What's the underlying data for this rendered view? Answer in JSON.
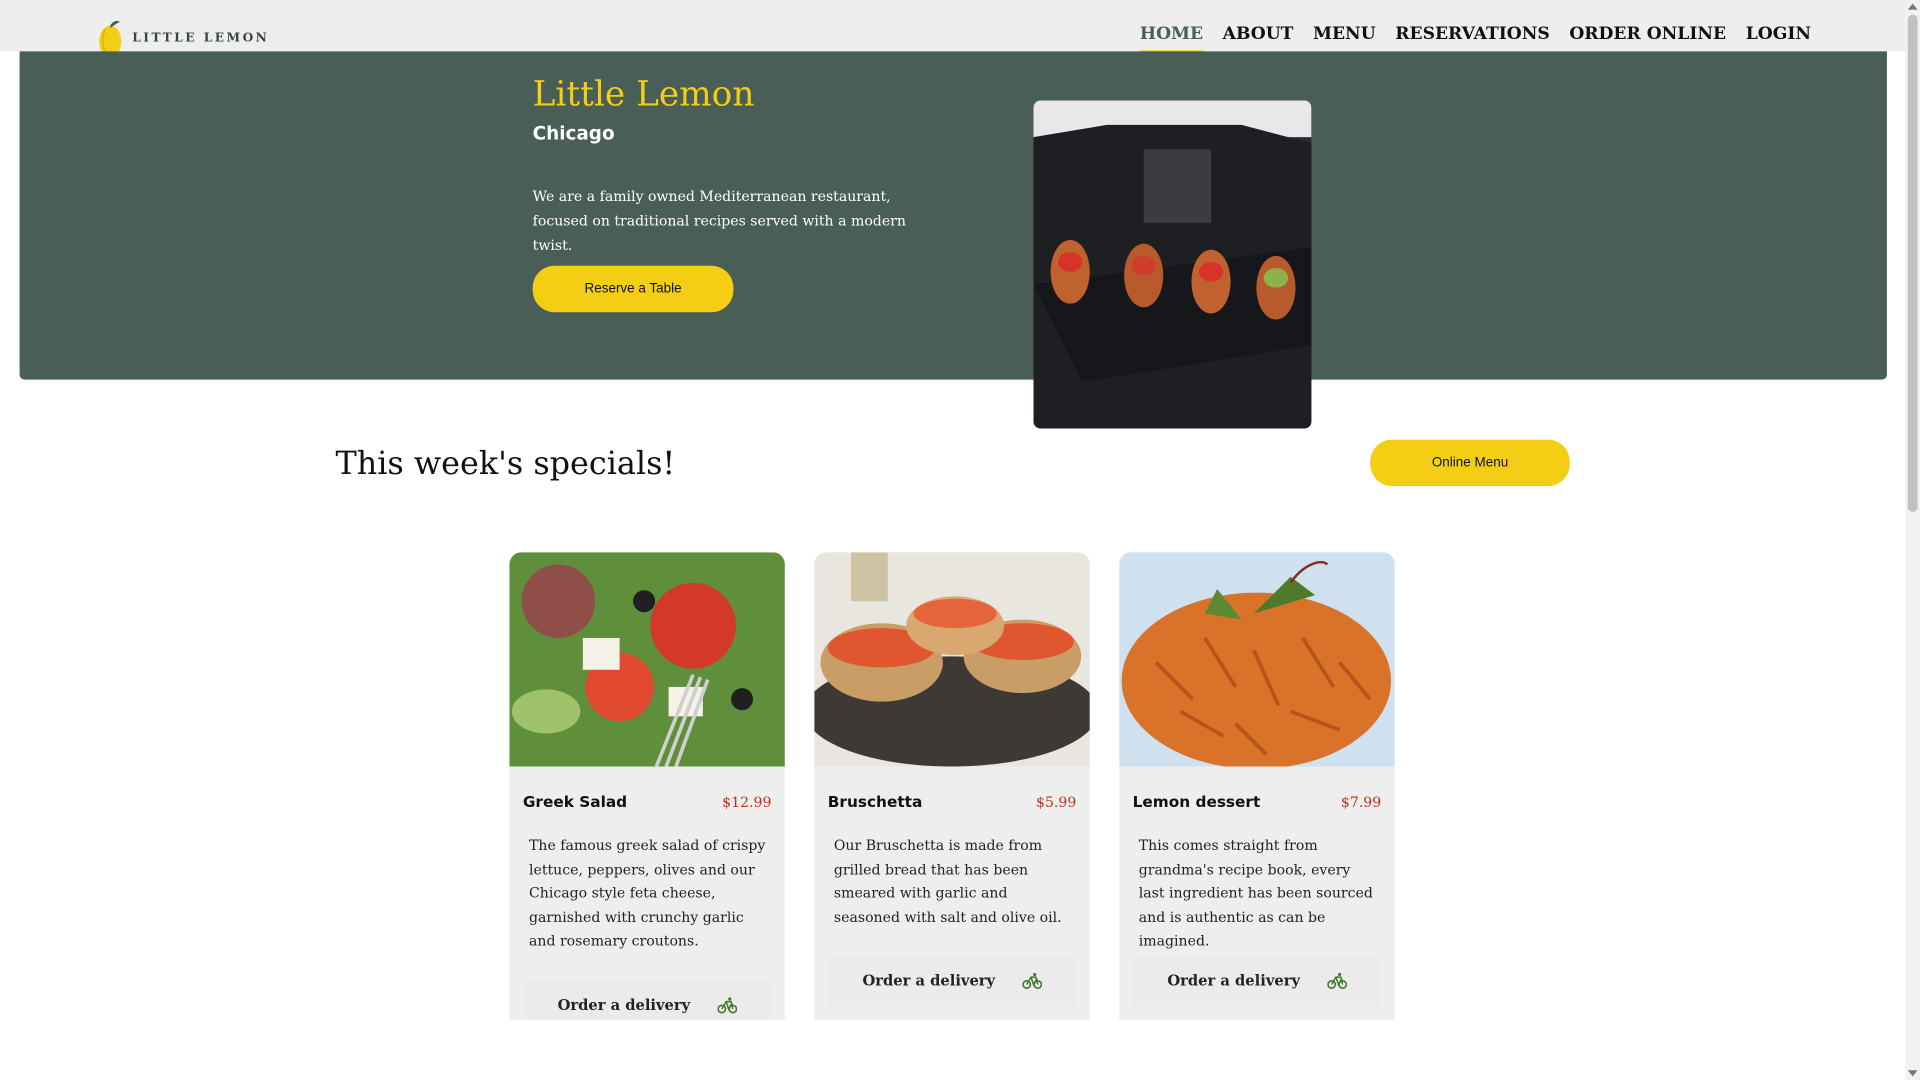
{
  "brand": {
    "logo_text": "LITTLE LEMON",
    "accent": "#f4ce14",
    "primary": "#495e57"
  },
  "nav": [
    {
      "label": "HOME",
      "active": true
    },
    {
      "label": "ABOUT"
    },
    {
      "label": "MENU"
    },
    {
      "label": "RESERVATIONS"
    },
    {
      "label": "ORDER ONLINE"
    },
    {
      "label": "LOGIN"
    }
  ],
  "hero": {
    "title": "Little Lemon",
    "subtitle": "Chicago",
    "description": "We are a family owned Mediterranean restaurant, focused on traditional recipes served with a modern twist.",
    "button_label": "Reserve a Table"
  },
  "specials": {
    "title": "This week's specials!",
    "menu_button_label": "Online Menu",
    "cards": [
      {
        "name": "Greek Salad",
        "price": "$12.99",
        "description": "The famous greek salad of crispy lettuce, peppers, olives and our Chicago style feta cheese, garnished with crunchy garlic and rosemary croutons.",
        "delivery_label": "Order a delivery",
        "icon": "bike-icon"
      },
      {
        "name": "Bruschetta",
        "price": "$5.99",
        "description": "Our Bruschetta is made from grilled bread that has been smeared with garlic and seasoned with salt and olive oil.",
        "delivery_label": "Order a delivery",
        "icon": "bike-icon"
      },
      {
        "name": "Lemon dessert",
        "price": "$7.99",
        "description": "This comes straight from grandma's recipe book, every last ingredient has been sourced and is authentic as can be imagined.",
        "delivery_label": "Order a delivery",
        "icon": "bike-icon"
      }
    ]
  }
}
